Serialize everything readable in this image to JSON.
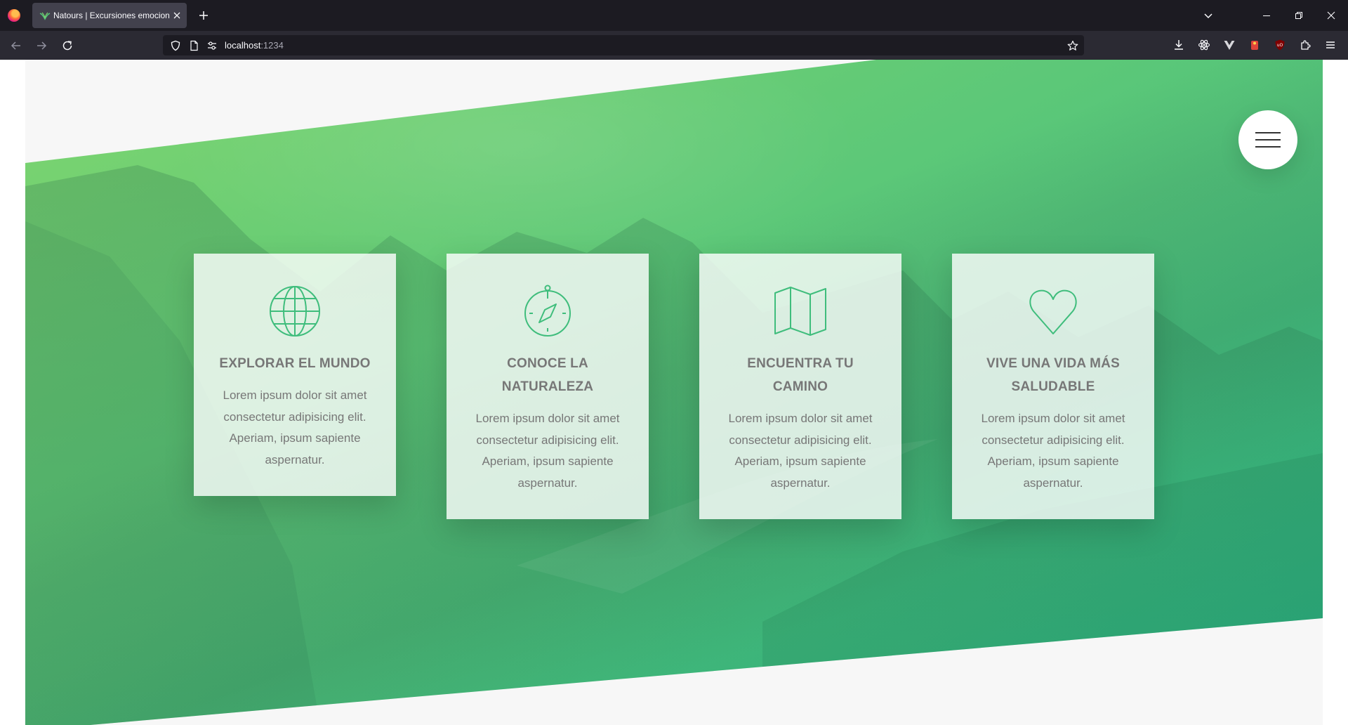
{
  "browser": {
    "tab_title": "Natours | Excursiones emocionantes",
    "url_host": "localhost",
    "url_port": ":1234"
  },
  "colors": {
    "green_light": "#7ed56f",
    "green": "#55c57a",
    "green_dark": "#28b485",
    "text_grey": "#777777"
  },
  "features": [
    {
      "icon": "globe-icon",
      "title_lines": [
        "EXPLORAR EL MUNDO"
      ],
      "text_lines": [
        "Lorem ipsum dolor sit amet",
        "consectetur adipisicing elit.",
        "Aperiam, ipsum sapiente",
        "aspernatur."
      ]
    },
    {
      "icon": "compass-icon",
      "title_lines": [
        "CONOCE LA",
        "NATURALEZA"
      ],
      "text_lines": [
        "Lorem ipsum dolor sit amet",
        "consectetur adipisicing elit.",
        "Aperiam, ipsum sapiente",
        "aspernatur."
      ]
    },
    {
      "icon": "map-icon",
      "title_lines": [
        "ENCUENTRA TU",
        "CAMINO"
      ],
      "text_lines": [
        "Lorem ipsum dolor sit amet",
        "consectetur adipisicing elit.",
        "Aperiam, ipsum sapiente",
        "aspernatur."
      ]
    },
    {
      "icon": "heart-icon",
      "title_lines": [
        "VIVE UNA VIDA MÁS",
        "SALUDABLE"
      ],
      "text_lines": [
        "Lorem ipsum dolor sit amet",
        "consectetur adipisicing elit.",
        "Aperiam, ipsum sapiente",
        "aspernatur."
      ]
    }
  ]
}
